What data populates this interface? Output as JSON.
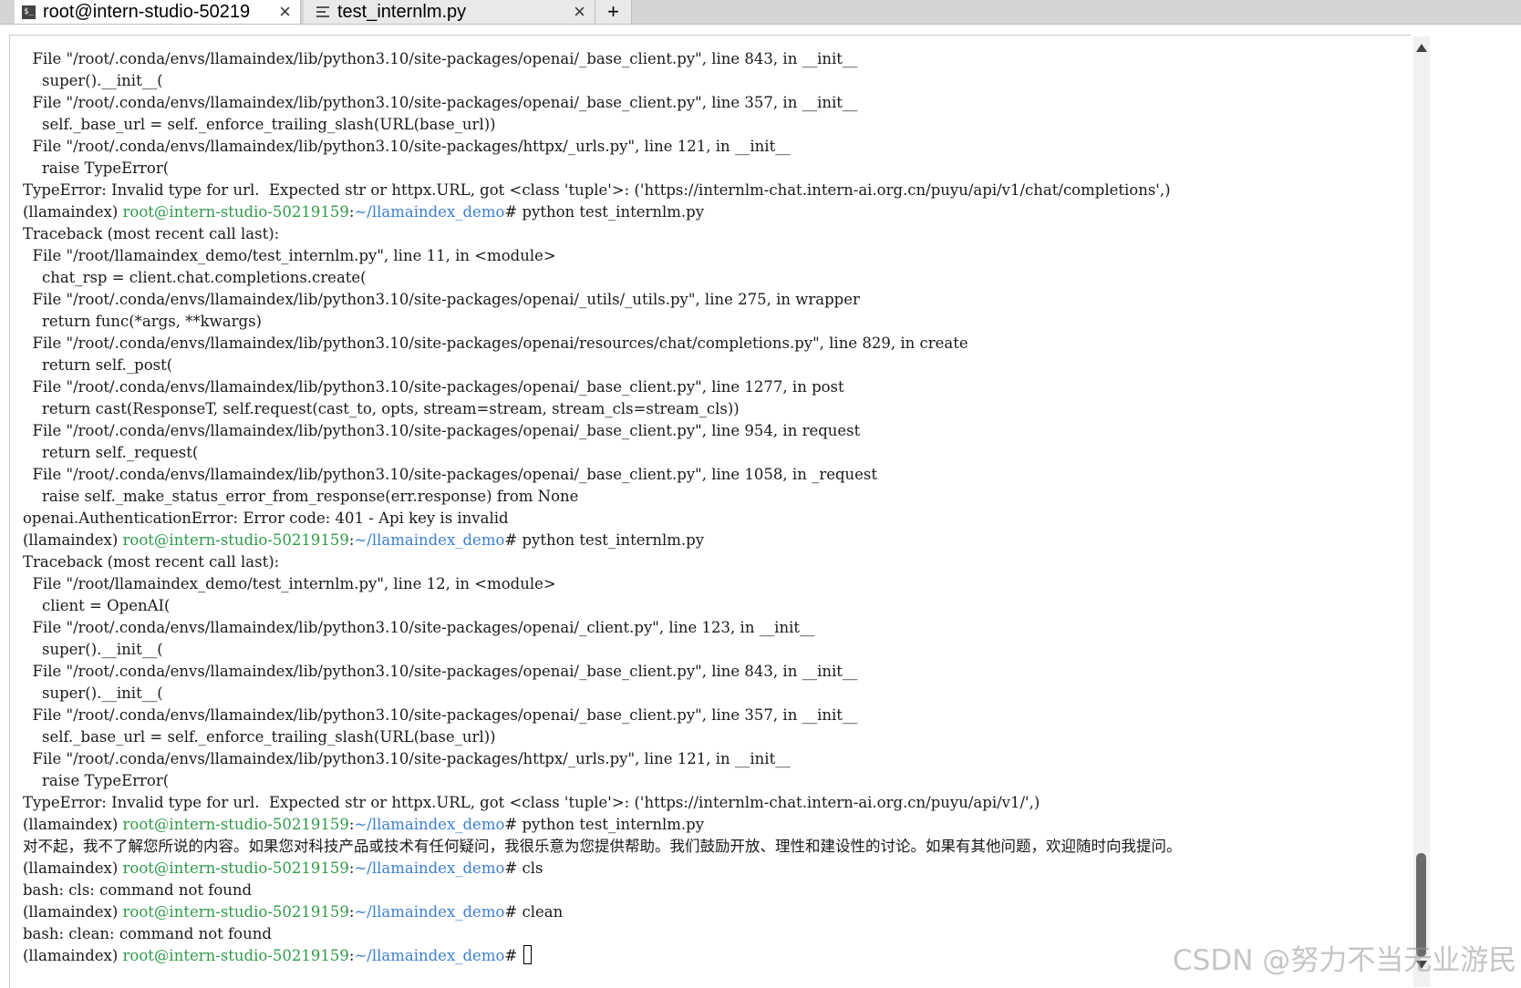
{
  "tabs": [
    {
      "icon": "terminal-icon",
      "label": "root@intern-studio-50219",
      "close": "×"
    },
    {
      "icon": "document-icon",
      "label": "test_internlm.py",
      "close": "×"
    }
  ],
  "new_tab_label": "+",
  "prompt": {
    "venv": "(llamaindex)",
    "user_host": "root@intern-studio-50219159",
    "colon": ":",
    "path": "~/llamaindex_demo",
    "symbol": "#",
    "colors": {
      "user_host": "#2f9a49",
      "path": "#3c7fd0"
    }
  },
  "terminal": {
    "lines": [
      {
        "type": "text",
        "text": "  File \"/root/.conda/envs/llamaindex/lib/python3.10/site-packages/openai/_base_client.py\", line 843, in __init__"
      },
      {
        "type": "text",
        "text": "    super().__init__("
      },
      {
        "type": "text",
        "text": "  File \"/root/.conda/envs/llamaindex/lib/python3.10/site-packages/openai/_base_client.py\", line 357, in __init__"
      },
      {
        "type": "text",
        "text": "    self._base_url = self._enforce_trailing_slash(URL(base_url))"
      },
      {
        "type": "text",
        "text": "  File \"/root/.conda/envs/llamaindex/lib/python3.10/site-packages/httpx/_urls.py\", line 121, in __init__"
      },
      {
        "type": "text",
        "text": "    raise TypeError("
      },
      {
        "type": "text",
        "text": "TypeError: Invalid type for url.  Expected str or httpx.URL, got <class 'tuple'>: ('https://internlm-chat.intern-ai.org.cn/puyu/api/v1/chat/completions',)"
      },
      {
        "type": "prompt",
        "cmd": " python test_internlm.py"
      },
      {
        "type": "text",
        "text": "Traceback (most recent call last):"
      },
      {
        "type": "text",
        "text": "  File \"/root/llamaindex_demo/test_internlm.py\", line 11, in <module>"
      },
      {
        "type": "text",
        "text": "    chat_rsp = client.chat.completions.create("
      },
      {
        "type": "text",
        "text": "  File \"/root/.conda/envs/llamaindex/lib/python3.10/site-packages/openai/_utils/_utils.py\", line 275, in wrapper"
      },
      {
        "type": "text",
        "text": "    return func(*args, **kwargs)"
      },
      {
        "type": "text",
        "text": "  File \"/root/.conda/envs/llamaindex/lib/python3.10/site-packages/openai/resources/chat/completions.py\", line 829, in create"
      },
      {
        "type": "text",
        "text": "    return self._post("
      },
      {
        "type": "text",
        "text": "  File \"/root/.conda/envs/llamaindex/lib/python3.10/site-packages/openai/_base_client.py\", line 1277, in post"
      },
      {
        "type": "text",
        "text": "    return cast(ResponseT, self.request(cast_to, opts, stream=stream, stream_cls=stream_cls))"
      },
      {
        "type": "text",
        "text": "  File \"/root/.conda/envs/llamaindex/lib/python3.10/site-packages/openai/_base_client.py\", line 954, in request"
      },
      {
        "type": "text",
        "text": "    return self._request("
      },
      {
        "type": "text",
        "text": "  File \"/root/.conda/envs/llamaindex/lib/python3.10/site-packages/openai/_base_client.py\", line 1058, in _request"
      },
      {
        "type": "text",
        "text": "    raise self._make_status_error_from_response(err.response) from None"
      },
      {
        "type": "text",
        "text": "openai.AuthenticationError: Error code: 401 - Api key is invalid"
      },
      {
        "type": "prompt",
        "cmd": " python test_internlm.py"
      },
      {
        "type": "text",
        "text": "Traceback (most recent call last):"
      },
      {
        "type": "text",
        "text": "  File \"/root/llamaindex_demo/test_internlm.py\", line 12, in <module>"
      },
      {
        "type": "text",
        "text": "    client = OpenAI("
      },
      {
        "type": "text",
        "text": "  File \"/root/.conda/envs/llamaindex/lib/python3.10/site-packages/openai/_client.py\", line 123, in __init__"
      },
      {
        "type": "text",
        "text": "    super().__init__("
      },
      {
        "type": "text",
        "text": "  File \"/root/.conda/envs/llamaindex/lib/python3.10/site-packages/openai/_base_client.py\", line 843, in __init__"
      },
      {
        "type": "text",
        "text": "    super().__init__("
      },
      {
        "type": "text",
        "text": "  File \"/root/.conda/envs/llamaindex/lib/python3.10/site-packages/openai/_base_client.py\", line 357, in __init__"
      },
      {
        "type": "text",
        "text": "    self._base_url = self._enforce_trailing_slash(URL(base_url))"
      },
      {
        "type": "text",
        "text": "  File \"/root/.conda/envs/llamaindex/lib/python3.10/site-packages/httpx/_urls.py\", line 121, in __init__"
      },
      {
        "type": "text",
        "text": "    raise TypeError("
      },
      {
        "type": "text",
        "text": "TypeError: Invalid type for url.  Expected str or httpx.URL, got <class 'tuple'>: ('https://internlm-chat.intern-ai.org.cn/puyu/api/v1/',)"
      },
      {
        "type": "prompt",
        "cmd": " python test_internlm.py"
      },
      {
        "type": "text",
        "text": "对不起，我不了解您所说的内容。如果您对科技产品或技术有任何疑问，我很乐意为您提供帮助。我们鼓励开放、理性和建设性的讨论。如果有其他问题，欢迎随时向我提问。"
      },
      {
        "type": "prompt",
        "cmd": " cls"
      },
      {
        "type": "text",
        "text": "bash: cls: command not found"
      },
      {
        "type": "prompt",
        "cmd": " clean"
      },
      {
        "type": "text",
        "text": "bash: clean: command not found"
      },
      {
        "type": "prompt",
        "cmd": " ",
        "cursor": true
      }
    ]
  },
  "watermark": "CSDN @努力不当无业游民"
}
